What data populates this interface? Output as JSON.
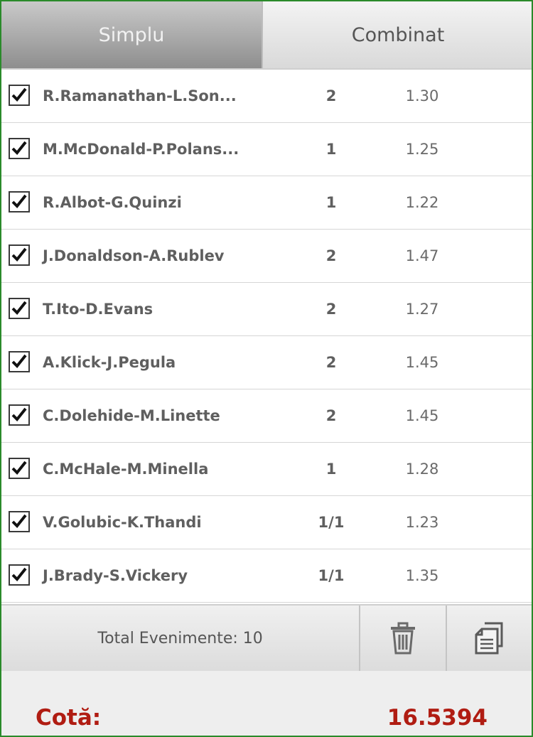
{
  "tabs": {
    "simplu": "Simplu",
    "combinat": "Combinat"
  },
  "bets": [
    {
      "match": "R.Ramanathan-L.Son...",
      "pick": "2",
      "odd": "1.30",
      "checked": true
    },
    {
      "match": "M.McDonald-P.Polans...",
      "pick": "1",
      "odd": "1.25",
      "checked": true
    },
    {
      "match": "R.Albot-G.Quinzi",
      "pick": "1",
      "odd": "1.22",
      "checked": true
    },
    {
      "match": "J.Donaldson-A.Rublev",
      "pick": "2",
      "odd": "1.47",
      "checked": true
    },
    {
      "match": "T.Ito-D.Evans",
      "pick": "2",
      "odd": "1.27",
      "checked": true
    },
    {
      "match": "A.Klick-J.Pegula",
      "pick": "2",
      "odd": "1.45",
      "checked": true
    },
    {
      "match": "C.Dolehide-M.Linette",
      "pick": "2",
      "odd": "1.45",
      "checked": true
    },
    {
      "match": "C.McHale-M.Minella",
      "pick": "1",
      "odd": "1.28",
      "checked": true
    },
    {
      "match": "V.Golubic-K.Thandi",
      "pick": "1/1",
      "odd": "1.23",
      "checked": true
    },
    {
      "match": "J.Brady-S.Vickery",
      "pick": "1/1",
      "odd": "1.35",
      "checked": true
    }
  ],
  "footer": {
    "total_label": "Total Evenimente: 10",
    "trash_icon": "trash-icon",
    "copy_icon": "copy-icon"
  },
  "cota": {
    "label": "Cotă:",
    "value": "16.5394"
  },
  "colors": {
    "frame_border": "#2a8a2a",
    "cota_red": "#b01c12"
  }
}
